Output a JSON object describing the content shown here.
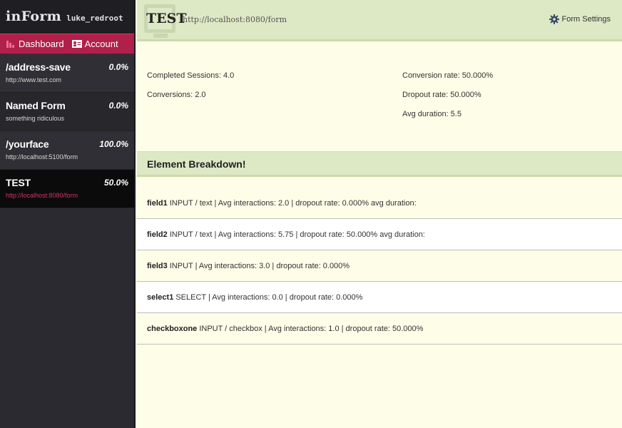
{
  "brand": {
    "app": "inForm",
    "user": "luke_redroot"
  },
  "nav": {
    "dashboard_label": "Dashboard",
    "account_label": "Account"
  },
  "forms": [
    {
      "name": "/address-save",
      "percent": "0.0%",
      "url": "http://www.test.com"
    },
    {
      "name": "Named Form",
      "percent": "0.0%",
      "url": "something ridiculous"
    },
    {
      "name": "/yourface",
      "percent": "100.0%",
      "url": "http://localhost:5100/form"
    },
    {
      "name": "TEST",
      "percent": "50.0%",
      "url": "http://localhost:8080/form"
    }
  ],
  "header": {
    "title": "TEST",
    "url": "http://localhost:8080/form",
    "settings_label": "Form Settings"
  },
  "stats": {
    "completed_sessions": "Completed Sessions: 4.0",
    "conversions": "Conversions: 2.0",
    "conversion_rate": "Conversion rate: 50.000%",
    "dropout_rate": "Dropout rate: 50.000%",
    "avg_duration": "Avg duration: 5.5"
  },
  "breakdown": {
    "title": "Element Breakdown!",
    "elements": [
      {
        "name": "field1",
        "details": "INPUT / text | Avg interactions: 2.0 | dropout rate: 0.000% avg duration:"
      },
      {
        "name": "field2",
        "details": "INPUT / text | Avg interactions: 5.75 | dropout rate: 50.000% avg duration:"
      },
      {
        "name": "field3",
        "details": "INPUT | Avg interactions: 3.0 | dropout rate: 0.000%"
      },
      {
        "name": "select1",
        "details": "SELECT | Avg interactions: 0.0 | dropout rate: 0.000%"
      },
      {
        "name": "checkboxone",
        "details": "INPUT / checkbox | Avg interactions: 1.0 | dropout rate: 50.000%"
      }
    ]
  },
  "colors": {
    "accent": "#b0204a",
    "sidebar_bg": "#2b2a30",
    "header_bg": "#dde8c5",
    "content_bg": "#fdfde8",
    "active_url": "#d9306a"
  },
  "icons": {
    "dashboard": "bar-chart-icon",
    "account": "id-card-icon",
    "settings": "gear-icon"
  }
}
